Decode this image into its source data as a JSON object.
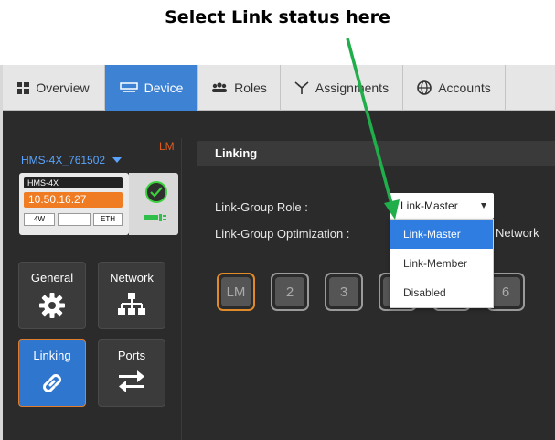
{
  "callout": "Select Link status here",
  "tabs": [
    {
      "label": "Overview",
      "icon": "grid-icon"
    },
    {
      "label": "Device",
      "icon": "device-icon"
    },
    {
      "label": "Roles",
      "icon": "users-icon"
    },
    {
      "label": "Assignments",
      "icon": "assignments-icon"
    },
    {
      "label": "Accounts",
      "icon": "globe-icon"
    }
  ],
  "device": {
    "badge": "LM",
    "name": "HMS-4X_761502",
    "model": "HMS-4X",
    "ip": "10.50.16.27",
    "port_a": "4W",
    "port_b": "",
    "port_c": "ETH"
  },
  "nav": [
    {
      "label": "General",
      "icon": "gear-icon"
    },
    {
      "label": "Network",
      "icon": "network-icon"
    },
    {
      "label": "Linking",
      "icon": "link-icon"
    },
    {
      "label": "Ports",
      "icon": "swap-arrows-icon"
    }
  ],
  "content": {
    "section_title": "Linking",
    "role_label": "Link-Group Role :",
    "optimization_label": "Link-Group Optimization :",
    "optimization_value_tail": "Network",
    "role_selected": "Link-Master",
    "role_options": [
      "Link-Master",
      "Link-Member",
      "Disabled"
    ],
    "slots": [
      "LM",
      "2",
      "3",
      "",
      "",
      "6"
    ]
  },
  "colors": {
    "accent": "#3d82d3",
    "orange": "#ef7b22",
    "arrow": "#1fae4a"
  }
}
